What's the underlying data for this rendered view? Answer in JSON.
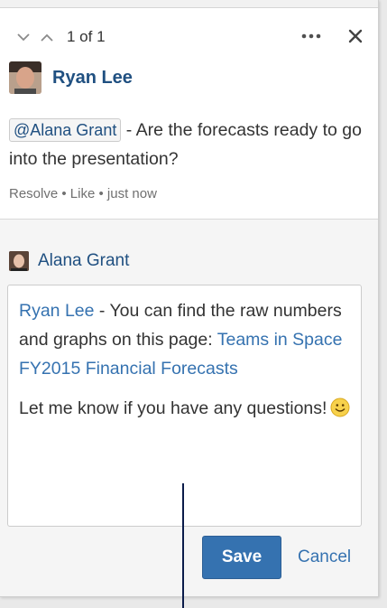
{
  "nav": {
    "count": "1 of 1"
  },
  "icons": {
    "prev": "chevron-down-icon",
    "next": "chevron-up-icon",
    "more": "more-icon",
    "close": "close-icon",
    "emoji": "smiley-icon"
  },
  "comment": {
    "author": "Ryan Lee",
    "mention": "@Alana Grant",
    "text": " - Are the forecasts ready to go into the presentation?",
    "actions": {
      "resolve": "Resolve",
      "like": "Like",
      "time": "just now",
      "separator": " • "
    }
  },
  "reply": {
    "author": "Alana Grant",
    "mention": "Ryan Lee",
    "text1": " - You can find the raw numbers and graphs on this page: ",
    "link": "Teams in Space FY2015 Financial Forecasts",
    "text2": "Let me know if you have any questions!"
  },
  "buttons": {
    "save": "Save",
    "cancel": "Cancel"
  },
  "colors": {
    "link": "#3572b0",
    "author": "#205081",
    "primary": "#3572b0",
    "muted": "#707070"
  }
}
